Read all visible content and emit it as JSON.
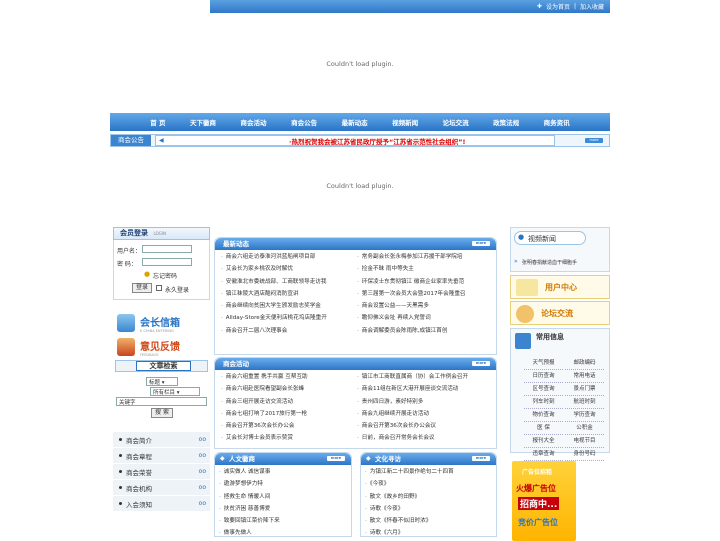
{
  "topbar": {
    "home": "设为首页",
    "fav": "加入收藏"
  },
  "plugin": {
    "msg1": "Couldn't load plugin.",
    "msg2": "Couldn't load plugin."
  },
  "nav": [
    "首 页",
    "天下徽商",
    "商会活动",
    "商会公告",
    "最新动态",
    "视频新闻",
    "论坛交流",
    "政策法规",
    "商务资讯"
  ],
  "notice": {
    "tag": "商会公告",
    "text": "·热烈祝贺我会被江苏省民政厅授予“江苏省示范性社会组织”!",
    "more": "more"
  },
  "login": {
    "title": "会员登录",
    "subtitle": "LOGIN",
    "user_label": "用户名：",
    "pass_label": "密  码：",
    "forgot": "忘记密码",
    "login_btn": "登录",
    "remember": "永久登录"
  },
  "side": {
    "mailbox": "会长信箱",
    "mailbox_en": "E-CHINA ENTERING",
    "feedback": "意见反馈",
    "feedback_en": "FEEDBACK",
    "search_title": "文章检索",
    "sel_title": "标题",
    "sel_column": "所有栏目",
    "keyword": "关键字",
    "search_btn": "搜 索"
  },
  "leftnav": [
    "商会简介",
    "商会章程",
    "商会荣誉",
    "商会机构",
    "入会须知"
  ],
  "news": {
    "title": "最新动态",
    "more": "more",
    "left": [
      "商会六组走访泰淮河洪蓝船闸项目部",
      "艾会长为家乡桃农及时解忧",
      "安徽淮北市委统战部、工商联领导走访我",
      "镇江秣陵大酒店酷闷消防宣讲",
      "商会继续向贫困大学生颁发励志奖学金",
      "Allday-Store金天便利店桃花坞店隆重开",
      "商会召开二届八次理事会"
    ],
    "right": [
      "常务副会长张永梅参加江苏援干部学院培",
      "捡金不昧  雨中等失主",
      "环保凌士东贯彻镇江 徽商企业家率先垂范",
      "第三届第一次会员大会暨2017年会隆重召",
      "商会设置公益——天黑需多",
      "瞻仰佛义会址  再续入党誓词",
      "商会调解委员会陈雨陈,成镇江首创"
    ]
  },
  "activity": {
    "title": "商会活动",
    "more": "more",
    "left": [
      "商会六组重置  携手共赢 互帮互助",
      "商会六组赴医院看望副会长张峰",
      "商会三组开展走访交流活动",
      "商会七组打响了2017旅行第一枪",
      "商会召开第36次会长办公会",
      "艾会长对博士会员表示赞赏"
    ],
    "right": [
      "镇江市工商联直属商（协）会工作例会召开",
      "商会11组在新区大港开展座谈交流活动",
      "贵州四日游，素好特别多",
      "商会九组继续开展走访活动",
      "商会召开第36次会长办公会议",
      "日前，商会召开常务会长会议"
    ]
  },
  "humanities": {
    "title": "人文徽商",
    "more": "more",
    "items": [
      "诚实做人  诚信谋事",
      "遨游梦想伊力特",
      "拯救生命 情暖人间",
      "扶贫济困 慈善博爱",
      "致要回镇江菜价降下来",
      "做事先做人"
    ]
  },
  "culture": {
    "title": "文化寻访",
    "more": "more",
    "items": [
      "为镇江新二十四景作绝句二十四首",
      "《今夜》",
      "散文《故乡的田野》",
      "诗歌《今夜》",
      "散文《怀春不似旧时浓》",
      "诗歌《六月》"
    ]
  },
  "right": {
    "video_title": "视频新闻",
    "video_caption": "张明春捐献造血干细胞手",
    "user_center": "用户中心",
    "forum": "论坛交流",
    "common_title": "常用信息",
    "common_items": [
      "天气预报",
      "邮政编码",
      "日历查询",
      "常用电话",
      "区号查询",
      "景点门票",
      "列车时刻",
      "航班时刻",
      "物价查询",
      "学历查询",
      "医  保",
      "公积金",
      "报刊大全",
      "电视节目",
      "违章查询",
      "身份号码"
    ],
    "ad1": "广告位招租",
    "ad2": "火爆广告位",
    "ad3": "招商中...",
    "ad4": "竞价广告位"
  }
}
